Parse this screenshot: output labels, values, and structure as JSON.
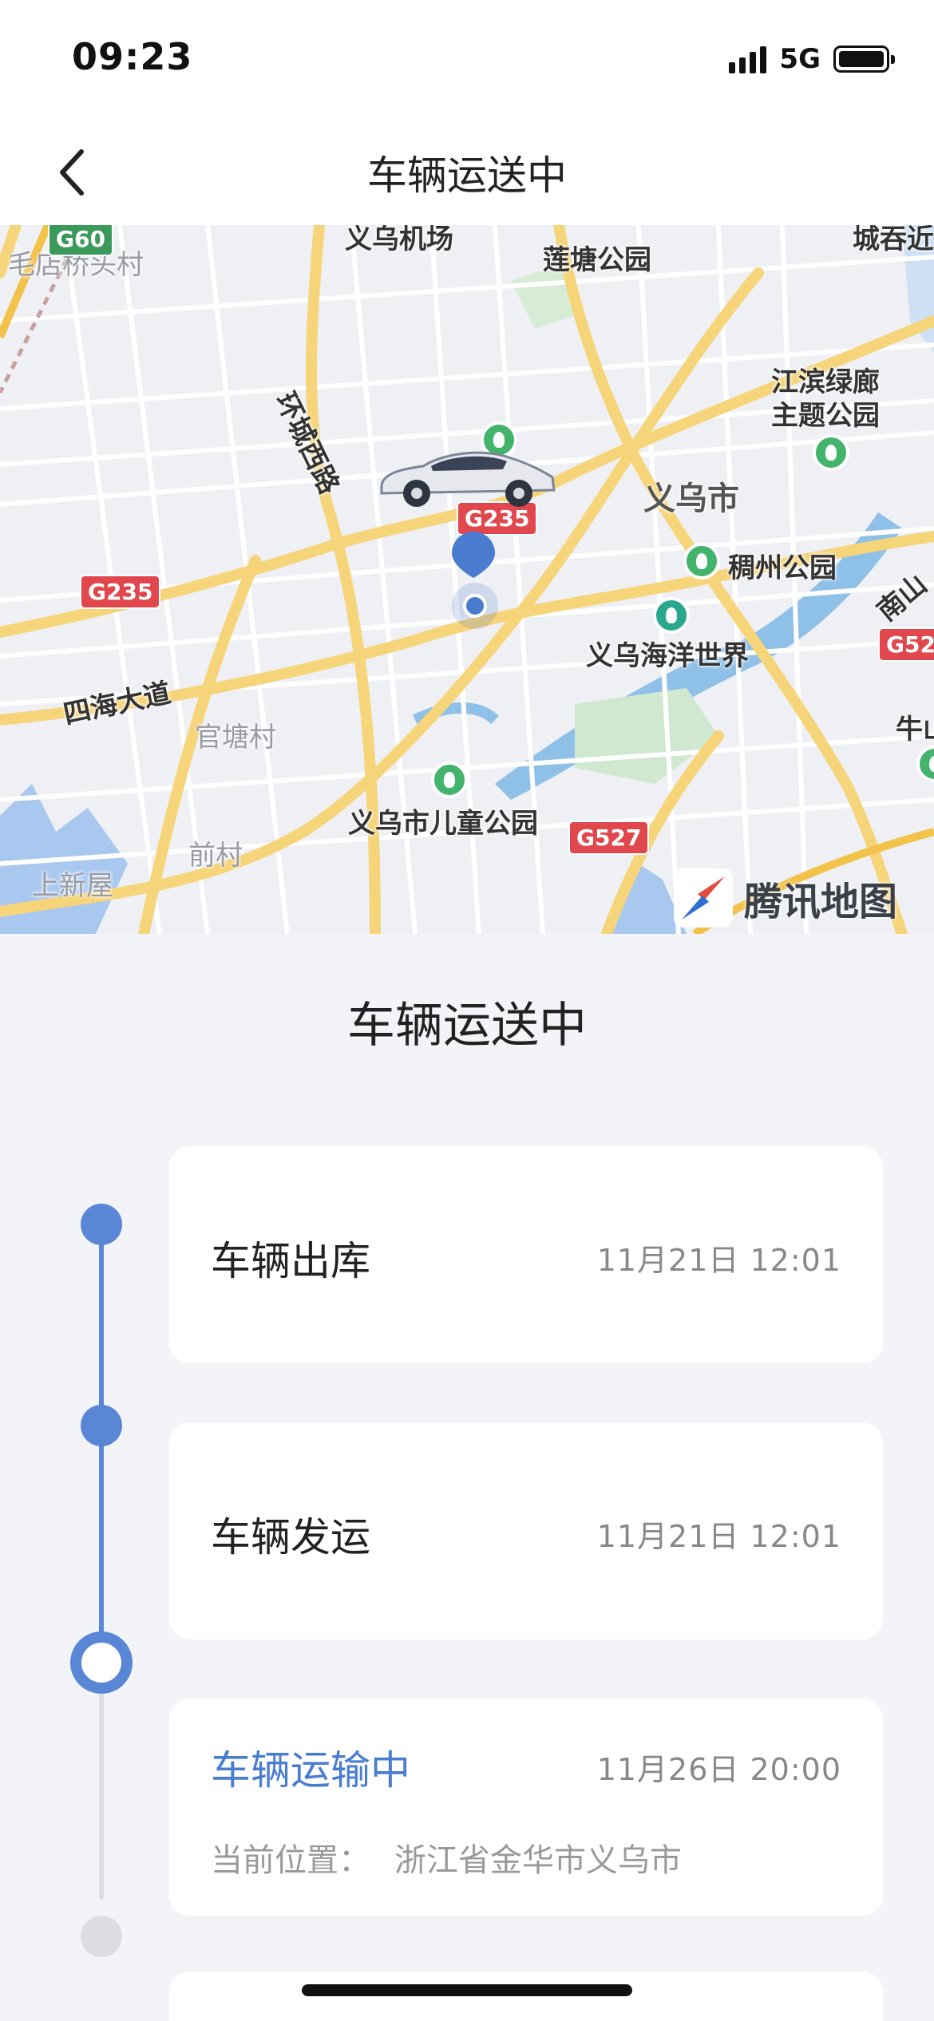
{
  "status_bar": {
    "time": "09:23",
    "network": "5G",
    "icons": [
      "signal-icon",
      "battery-icon"
    ]
  },
  "nav": {
    "title": "车辆运送中",
    "back_icon": "chevron-left-icon"
  },
  "map": {
    "provider": "腾讯地图",
    "labels": {
      "yiwu_city": "义乌市",
      "liantang_park": "莲塘公园",
      "jiangbin_park": "江滨绿廊\n主题公园",
      "chouzhou_park": "稠州公园",
      "ocean_world": "义乌海洋世界",
      "sihai_road": "四海大道",
      "guantang_village": "官塘村",
      "qian_village": "前村",
      "children_park": "义乌市儿童公园",
      "huancheng_road": "环城西路",
      "maodian_village": "毛店桥头村",
      "shangxin_wu": "上新屋",
      "yiwu_airport": "义乌机场",
      "chenggu": "城吞近",
      "nanshan": "南山",
      "niushan": "牛山"
    },
    "road_badges": {
      "g60": "G60",
      "g235_center": "G235",
      "g235_west": "G235",
      "g527": "G527",
      "g52_east": "G52"
    }
  },
  "heading": "车辆运送中",
  "steps": [
    {
      "title": "车辆出库",
      "time": "11月21日 12:01",
      "state": "done"
    },
    {
      "title": "车辆发运",
      "time": "11月21日 12:01",
      "state": "done"
    },
    {
      "title": "车辆运输中",
      "time": "11月26日 20:00",
      "state": "current",
      "location_label": "当前位置：",
      "location_value": "浙江省金华市义乌市"
    }
  ],
  "colors": {
    "accent": "#4a7dd0",
    "timeline_done": "#5a86d6",
    "timeline_pending": "#dcdde2",
    "background": "#f3f4f8"
  }
}
